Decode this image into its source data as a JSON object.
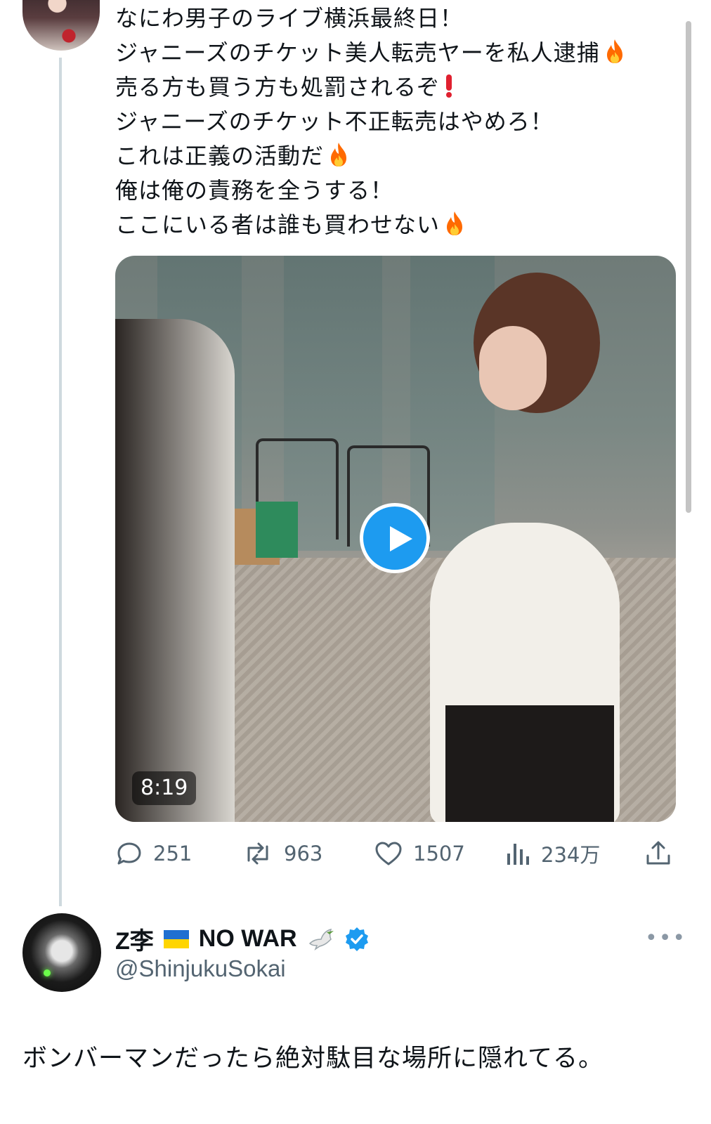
{
  "tweet": {
    "lines": [
      "なにわ男子のライブ横浜最終日！",
      "ジャニーズのチケット美人転売ヤーを私人逮捕",
      "売る方も買う方も処罰されるぞ",
      "ジャニーズのチケット不正転売はやめろ！",
      "これは正義の活動だ",
      "俺は俺の責務を全うする！",
      "ここにいる者は誰も買わせない"
    ],
    "emoji": {
      "fire": "fire-emoji",
      "exclamation": "red-exclamation-emoji"
    },
    "video": {
      "duration": "8:19"
    },
    "stats": {
      "replies": "251",
      "retweets": "963",
      "likes": "1507",
      "views": "234万"
    }
  },
  "reply": {
    "name_prefix": "Z李",
    "name_suffix": "NO WAR",
    "handle": "@ShinjukuSokai",
    "more": "•••",
    "text": "ボンバーマンだったら絶対駄目な場所に隠れてる。"
  },
  "colors": {
    "accent": "#1d9bf0",
    "text": "#0f1419",
    "secondary": "#536471",
    "fire": "#ff6a00",
    "exclamation": "#e0202f"
  }
}
